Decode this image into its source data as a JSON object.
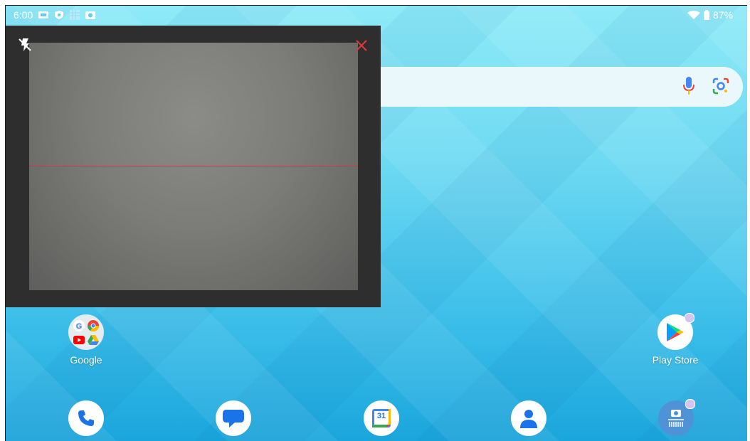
{
  "status_bar": {
    "time": "6:00",
    "battery": "87%"
  },
  "scanner": {
    "flash_icon": "flash-off-icon",
    "close_icon": "close-icon"
  },
  "search": {
    "mic_icon": "mic-icon",
    "lens_icon": "lens-icon"
  },
  "apps": {
    "google_folder": {
      "label": "Google"
    },
    "play_store": {
      "label": "Play Store"
    }
  },
  "dock": [
    {
      "name": "Phone",
      "icon": "phone-icon"
    },
    {
      "name": "Messages",
      "icon": "messages-icon"
    },
    {
      "name": "Calendar",
      "icon": "calendar-icon",
      "date": "31"
    },
    {
      "name": "Contacts",
      "icon": "contacts-icon"
    },
    {
      "name": "Scanner",
      "icon": "scanner-camera-icon"
    }
  ],
  "colors": {
    "scan_line": "#c83a3a",
    "close_red": "#e53935",
    "wallpaper_top": "#8eeaf7",
    "wallpaper_bottom": "#1aa6dc"
  }
}
